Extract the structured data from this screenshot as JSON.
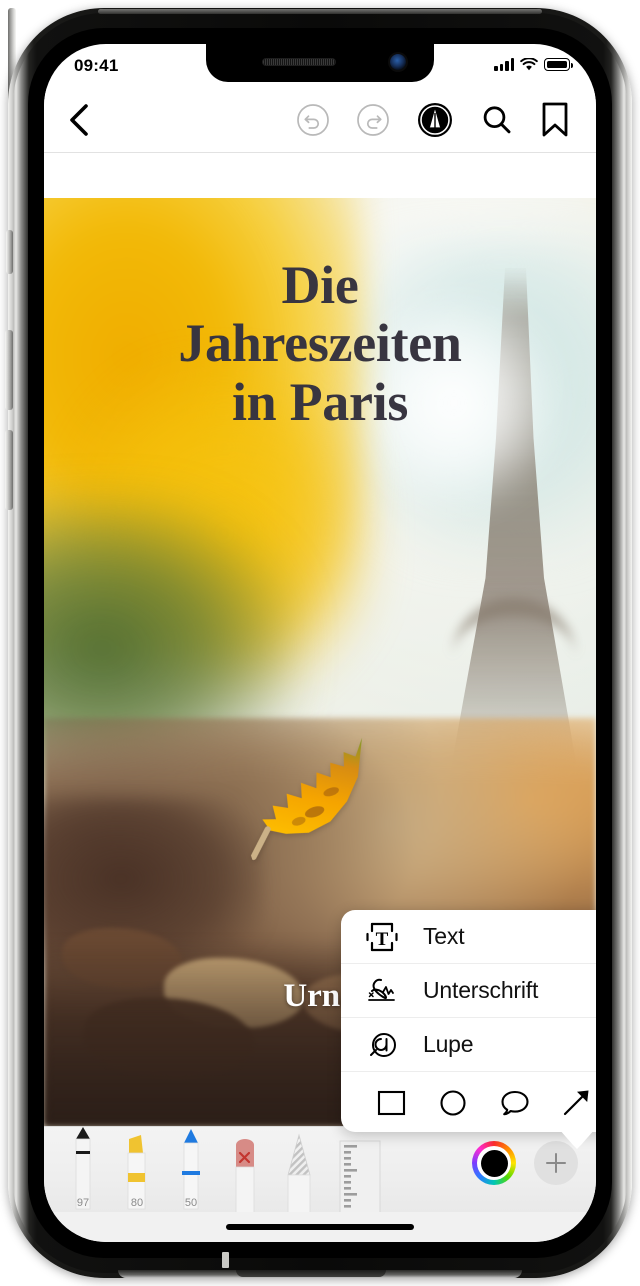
{
  "status_bar": {
    "time": "09:41",
    "signal_icon": "cellular-signal-icon",
    "wifi_icon": "wifi-icon",
    "battery_icon": "battery-full-icon"
  },
  "nav_bar": {
    "back_icon": "chevron-left-icon",
    "undo_icon": "undo-icon",
    "redo_icon": "redo-icon",
    "markup_icon": "markup-pen-icon",
    "search_icon": "search-icon",
    "bookmark_icon": "bookmark-icon",
    "undo_enabled": false,
    "redo_enabled": false,
    "markup_active": true
  },
  "document": {
    "title_lines": [
      "Die",
      "Jahreszeiten",
      "in Paris"
    ],
    "subtitle": "Urna",
    "title_color": "#383540",
    "subtitle_color": "#ffffff"
  },
  "popup_menu": {
    "items": [
      {
        "label": "Text",
        "icon": "text-box-icon"
      },
      {
        "label": "Unterschrift",
        "icon": "signature-icon"
      },
      {
        "label": "Lupe",
        "icon": "magnifier-loupe-icon"
      }
    ],
    "shapes": [
      {
        "name": "square-shape-icon"
      },
      {
        "name": "circle-shape-icon"
      },
      {
        "name": "speech-bubble-shape-icon"
      },
      {
        "name": "arrow-shape-icon"
      }
    ]
  },
  "palette": {
    "tools": [
      {
        "name": "pen-tool",
        "opacity_label": "97",
        "color": "#1a1a1a"
      },
      {
        "name": "highlighter-tool",
        "opacity_label": "80",
        "color": "#f0c330"
      },
      {
        "name": "marker-tool",
        "opacity_label": "50",
        "color": "#1f7ae0"
      },
      {
        "name": "eraser-tool",
        "opacity_label": "",
        "color": "#d78b86"
      },
      {
        "name": "pencil-tool",
        "opacity_label": "",
        "color": "#bdbdbd"
      },
      {
        "name": "ruler-tool",
        "opacity_label": "",
        "color": "#dcdcdc"
      }
    ],
    "color_picker": {
      "name": "color-wheel-picker",
      "selected_color": "#000000"
    },
    "add_button": {
      "name": "add-tool-button",
      "glyph": "+"
    }
  },
  "home_indicator": {
    "name": "home-indicator"
  }
}
